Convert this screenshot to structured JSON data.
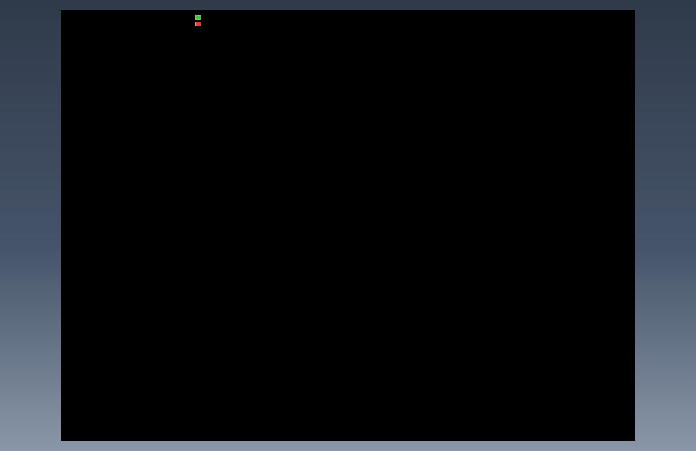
{
  "viewport": {
    "background": "#000000"
  },
  "colors": {
    "frame": "#00d8d8",
    "dimension": "#ff2020",
    "centerline": "#ff00ff",
    "strip": "#8a8a8a",
    "note": "#22dd22",
    "highlight": "#ffff00",
    "hole_blue": "#5a9cff"
  },
  "icons": {
    "legend": "layer-color-swatch-icon"
  }
}
